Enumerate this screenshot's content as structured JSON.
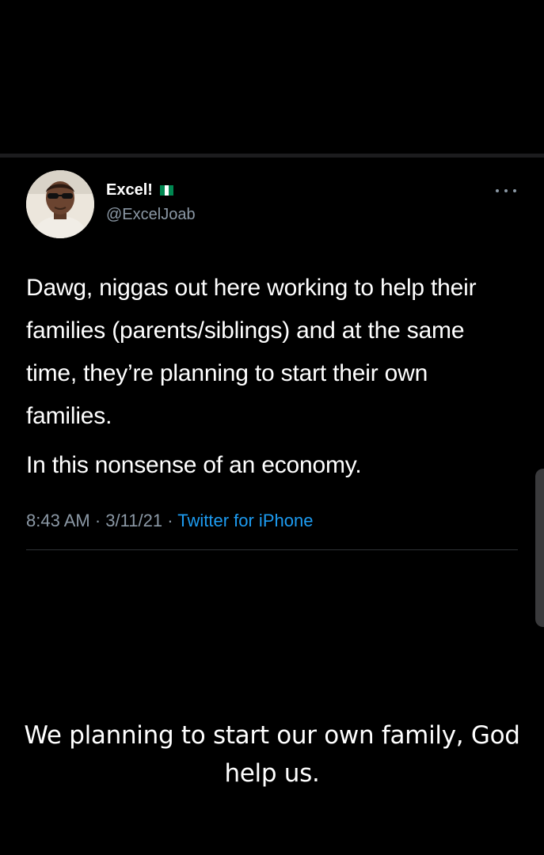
{
  "tweet": {
    "author": {
      "display_name": "Excel!",
      "handle": "@ExcelJoab",
      "flag_icon": "nigeria-flag-icon",
      "avatar_icon": "profile-photo"
    },
    "more_icon": "more-dots-icon",
    "text_paragraph_1": "Dawg, niggas out here working to help their families (parents/siblings) and at the same time, they’re planning to start their own families.",
    "text_paragraph_2": "In this nonsense of an economy.",
    "meta": {
      "time": "8:43 AM",
      "separator": "·",
      "date": "3/11/21",
      "source": "Twitter for iPhone"
    }
  },
  "caption": "We planning to start our own family, God help us.",
  "colors": {
    "background": "#000000",
    "text": "#ffffff",
    "secondary_text": "#8b98a5",
    "link": "#1d9bf0",
    "flag_green": "#008751",
    "flag_white": "#ffffff"
  }
}
